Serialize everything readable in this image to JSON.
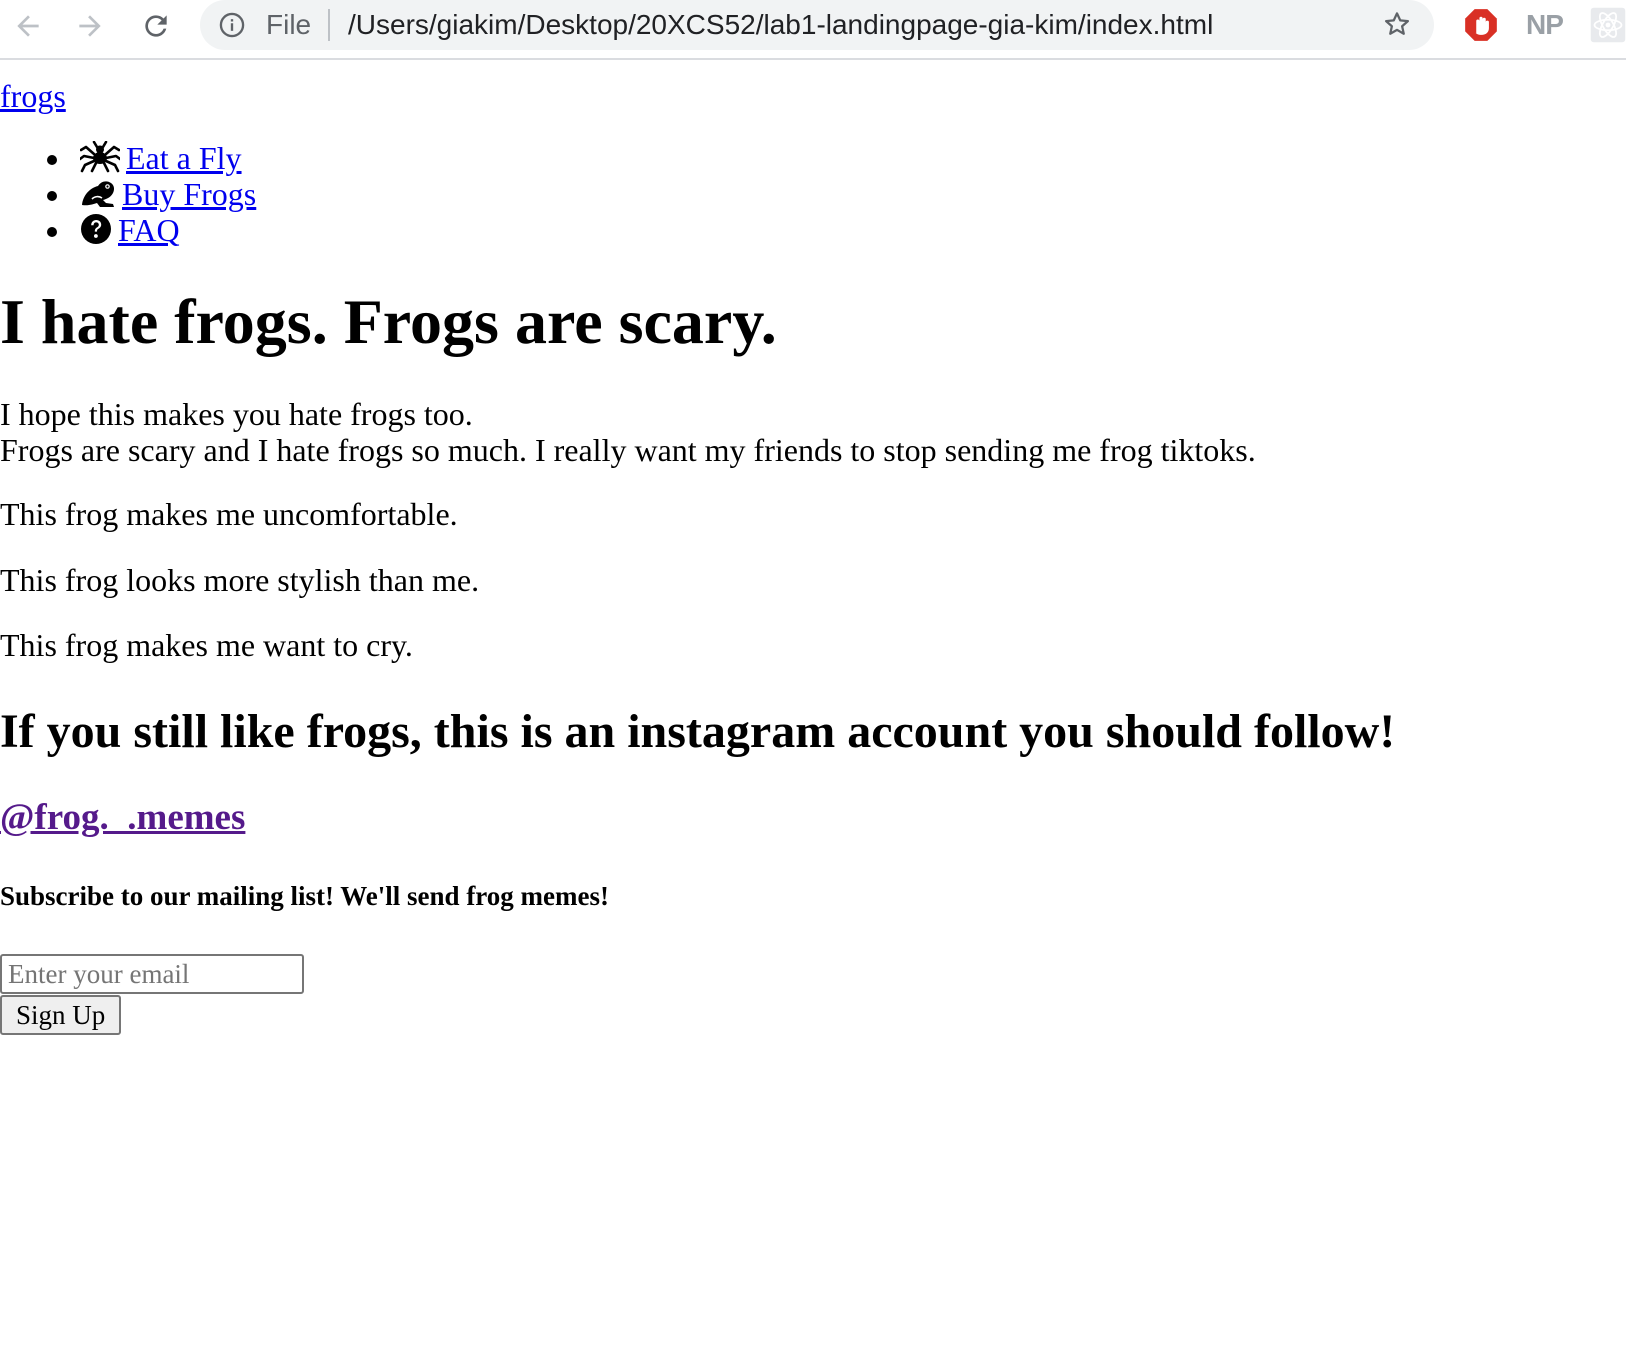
{
  "browser": {
    "info_icon": "info-circle-icon",
    "file_label": "File",
    "url": "/Users/giakim/Desktop/20XCS52/lab1-landingpage-gia-kim/index.html",
    "extensions": {
      "np_label": "NP"
    },
    "colors": {
      "toolbar_icon": "#5f6368",
      "omnibox_bg": "#f1f3f4",
      "adblock_red": "#d93025"
    }
  },
  "page": {
    "brand_link": "frogs",
    "nav": [
      {
        "label": "Eat a Fly",
        "icon": "spider-icon"
      },
      {
        "label": "Buy Frogs",
        "icon": "frog-icon"
      },
      {
        "label": "FAQ",
        "icon": "question-circle-icon"
      }
    ],
    "heading": "I hope this makes you hate frogs too.",
    "hero_title": "I hate frogs. Frogs are scary.",
    "intro_line1": "I hope this makes you hate frogs too.",
    "intro_line2": "Frogs are scary and I hate frogs so much. I really want my friends to stop sending me frog tiktoks.",
    "captions": [
      "This frog makes me uncomfortable.",
      "This frog looks more stylish than me.",
      "This frog makes me want to cry."
    ],
    "follow_heading": "If you still like frogs, this is an instagram account you should follow!",
    "instagram_handle": "@frog._.memes",
    "subscribe_heading": "Subscribe to our mailing list! We'll send frog memes!",
    "email_placeholder": "Enter your email",
    "email_value": "",
    "signup_label": "Sign Up",
    "colors": {
      "link": "#0000ee",
      "visited_link": "#551a8b"
    }
  }
}
